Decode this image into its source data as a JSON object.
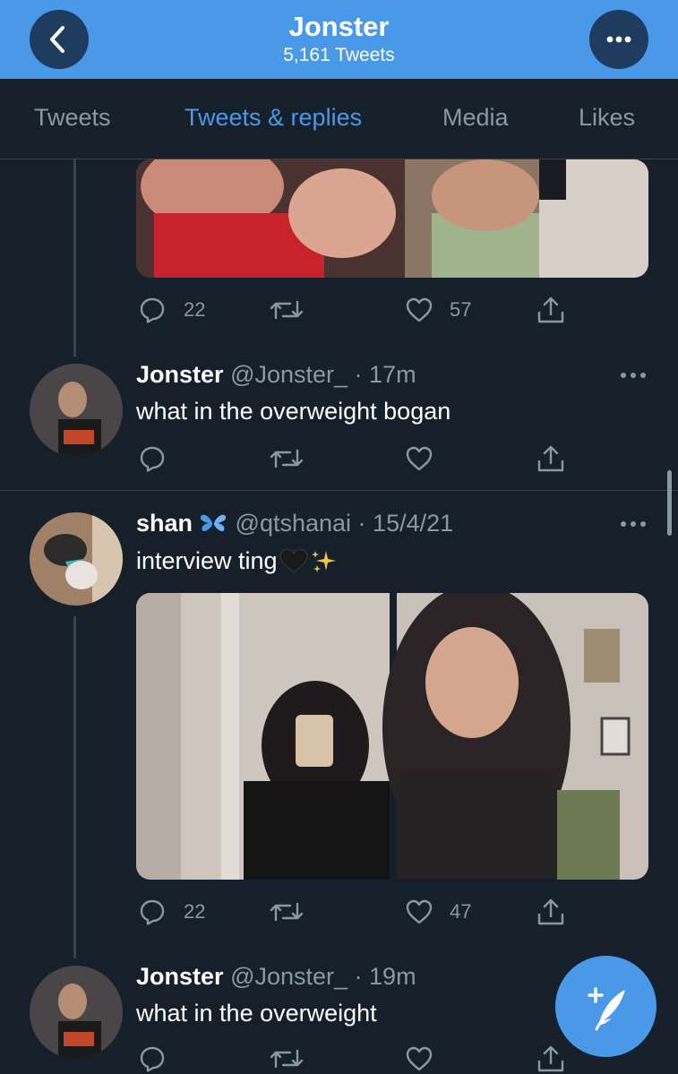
{
  "header": {
    "title": "Jonster",
    "subtitle": "5,161 Tweets"
  },
  "tabs": [
    {
      "label": "Tweets",
      "active": false
    },
    {
      "label": "Tweets & replies",
      "active": true
    },
    {
      "label": "Media",
      "active": false
    },
    {
      "label": "Likes",
      "active": false
    }
  ],
  "colors": {
    "background": "#15202b",
    "accent": "#4a99e9",
    "secondary_text": "#8899a6",
    "divider": "#38444d"
  },
  "top_tweet_actions": {
    "replies": "22",
    "likes": "57"
  },
  "tweets": [
    {
      "name": "Jonster",
      "handle": "@Jonster_",
      "time": "17m",
      "text": "what in the overweight bogan"
    },
    {
      "name": "shan",
      "handle": "@qtshanai",
      "time": "15/4/21",
      "text": "interview ting",
      "emoji": [
        "butterfly",
        "black-heart",
        "sparkles"
      ],
      "replies": "22",
      "likes": "47"
    },
    {
      "name": "Jonster",
      "handle": "@Jonster_",
      "time": "19m",
      "text": "what in the overweight"
    }
  ],
  "icons": {
    "back": "chevron-left-icon",
    "more": "more-horizontal-icon",
    "reply": "reply-icon",
    "retweet": "retweet-icon",
    "like": "heart-icon",
    "share": "share-icon",
    "compose": "compose-tweet-icon"
  }
}
